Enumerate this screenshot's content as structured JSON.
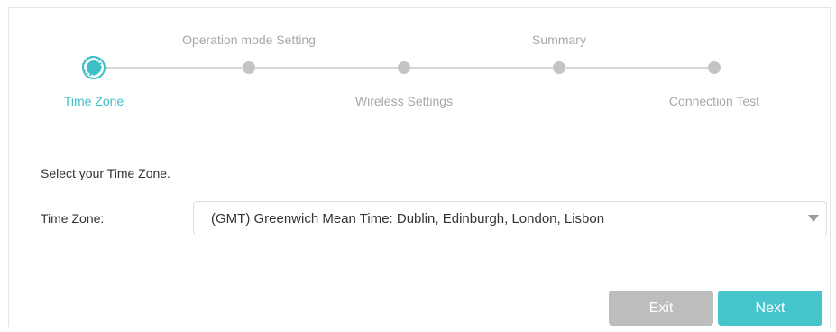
{
  "stepper": {
    "steps": [
      {
        "label": "Time Zone",
        "active": true
      },
      {
        "label": "Operation mode Setting",
        "active": false
      },
      {
        "label": "Wireless Settings",
        "active": false
      },
      {
        "label": "Summary",
        "active": false
      },
      {
        "label": "Connection Test",
        "active": false
      }
    ]
  },
  "form": {
    "prompt": "Select your Time Zone.",
    "time_zone_label": "Time Zone:",
    "time_zone_value": "(GMT) Greenwich Mean Time: Dublin, Edinburgh, London, Lisbon"
  },
  "buttons": {
    "exit_label": "Exit",
    "next_label": "Next"
  },
  "colors": {
    "accent": "#3cc0c7",
    "inactive": "#c4c4c4",
    "exit_button": "#bdbdbd",
    "next_button": "#45c4cc"
  }
}
